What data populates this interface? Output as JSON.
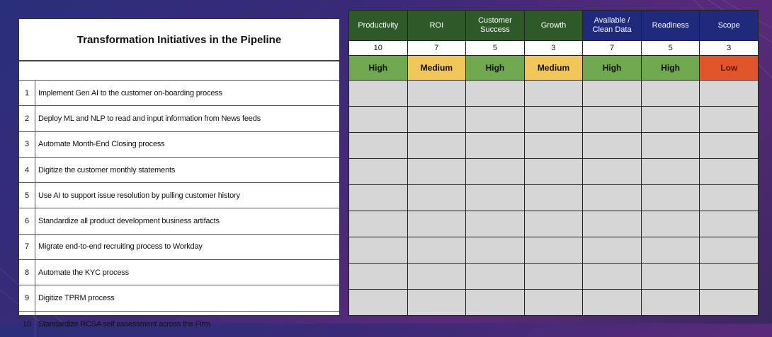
{
  "title": "Transformation Initiatives in the Pipeline",
  "initiatives": [
    {
      "num": "1",
      "text": "Implement Gen AI to the customer on-boarding process"
    },
    {
      "num": "2",
      "text": "Deploy ML and NLP to read and input information from News feeds"
    },
    {
      "num": "3",
      "text": "Automate Month-End Closing process"
    },
    {
      "num": "4",
      "text": "Digitize the customer monthly statements"
    },
    {
      "num": "5",
      "text": "Use AI to support issue resolution by pulling customer history"
    },
    {
      "num": "6",
      "text": "Standardize all product development business artifacts"
    },
    {
      "num": "7",
      "text": "Migrate end-to-end recruiting process to Workday"
    },
    {
      "num": "8",
      "text": "Automate the KYC process"
    },
    {
      "num": "9",
      "text": "Digitize TPRM process"
    },
    {
      "num": "10",
      "text": "Standardize RCSA self assessment across the Firm"
    }
  ],
  "criteria": [
    {
      "label": "Productivity",
      "weight": "10",
      "color": "#2e5a2a"
    },
    {
      "label": "ROI",
      "weight": "7",
      "color": "#2e5a2a"
    },
    {
      "label": "Customer Success",
      "weight": "5",
      "color": "#2e5a2a"
    },
    {
      "label": "Growth",
      "weight": "3",
      "color": "#2e5a2a"
    },
    {
      "label": "Available / Clean Data",
      "weight": "7",
      "color": "#1f2a7a"
    },
    {
      "label": "Readiness",
      "weight": "5",
      "color": "#1f2a7a"
    },
    {
      "label": "Scope",
      "weight": "3",
      "color": "#1f2a7a"
    }
  ],
  "row1_ratings": [
    {
      "value": "High",
      "color": "#6fa84f"
    },
    {
      "value": "Medium",
      "color": "#f2c75a"
    },
    {
      "value": "High",
      "color": "#6fa84f"
    },
    {
      "value": "Medium",
      "color": "#f2c75a"
    },
    {
      "value": "High",
      "color": "#6fa84f"
    },
    {
      "value": "High",
      "color": "#6fa84f"
    },
    {
      "value": "Low",
      "color": "#e2542a"
    }
  ]
}
